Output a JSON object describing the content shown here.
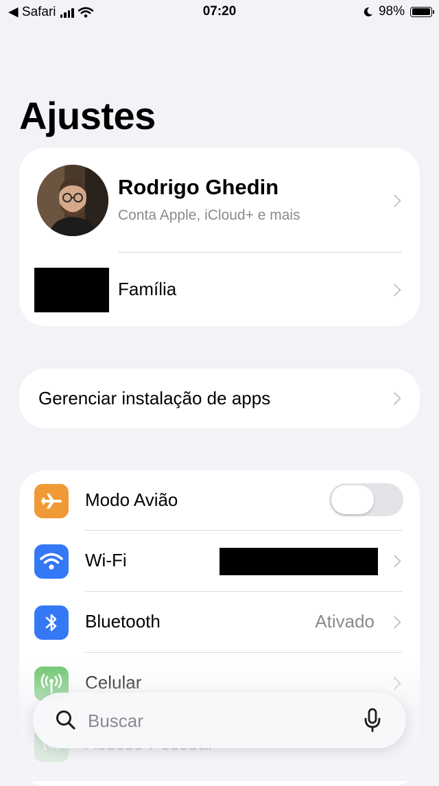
{
  "status_bar": {
    "back_label": "◀ Safari",
    "time": "07:20",
    "battery": "98%",
    "battery_level": 0.98
  },
  "page": {
    "title": "Ajustes"
  },
  "profile": {
    "name": "Rodrigo Ghedin",
    "subtitle": "Conta Apple, iCloud+ e mais",
    "family_label": "Família"
  },
  "manage": {
    "label": "Gerenciar instalação de apps"
  },
  "settings": {
    "airplane": {
      "label": "Modo Avião",
      "icon": "airplane-icon",
      "color": "#f09a37",
      "on": false
    },
    "wifi": {
      "label": "Wi-Fi",
      "icon": "wifi-icon",
      "color": "#3478f6"
    },
    "bluetooth": {
      "label": "Bluetooth",
      "value": "Ativado",
      "icon": "bluetooth-icon",
      "color": "#3478f6"
    },
    "cellular": {
      "label": "Celular",
      "icon": "antenna-icon",
      "color": "#65c466"
    },
    "hotspot": {
      "label": "Acesso Pessoal",
      "icon": "hotspot-icon",
      "color": "#65c466"
    }
  },
  "search": {
    "placeholder": "Buscar"
  }
}
